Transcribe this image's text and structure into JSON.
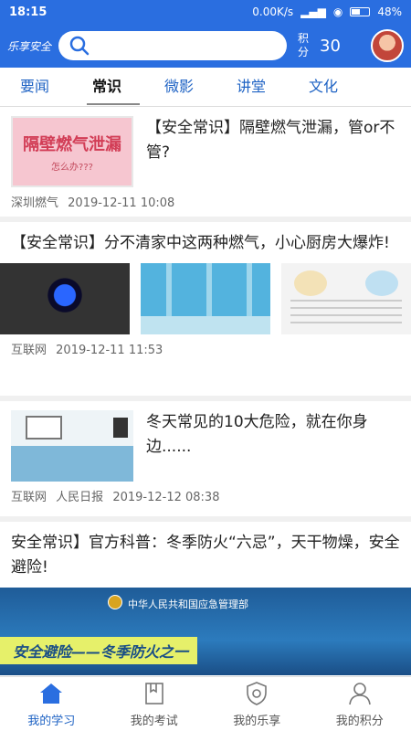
{
  "status_bar": {
    "time": "18:15",
    "network_speed": "0.00K/s",
    "battery": "48%",
    "battery_level": 0.48
  },
  "header": {
    "logo_text": "乐享安全",
    "search_icon": "search-icon",
    "points_label": "积分",
    "points_value": "30"
  },
  "tabs": [
    {
      "label": "要闻",
      "active": false
    },
    {
      "label": "常识",
      "active": true
    },
    {
      "label": "微影",
      "active": false
    },
    {
      "label": "讲堂",
      "active": false
    },
    {
      "label": "文化",
      "active": false
    }
  ],
  "articles": [
    {
      "title": "【安全常识】隔壁燃气泄漏，管or不管?",
      "thumb_big": "隔壁燃气泄漏",
      "thumb_small": "怎么办???",
      "source": "深圳燃气",
      "time": "2019-12-11 10:08"
    },
    {
      "title": "【安全常识】分不清家中这两种燃气，小心厨房大爆炸!",
      "source": "互联网",
      "time": "2019-12-11 11:53"
    },
    {
      "title": "冬天常见的10大危险，就在你身边......",
      "source": "互联网",
      "source2": "人民日报",
      "time": "2019-12-12 08:38"
    },
    {
      "title": "安全常识】官方科普：冬季防火“六忌”，天干物燥，安全避险!",
      "banner_org": "中华人民共和国应急管理部",
      "banner_cta": "安全避险——冬季防火之一"
    }
  ],
  "bottom_nav": [
    {
      "label": "我的学习",
      "icon": "home-icon",
      "active": true
    },
    {
      "label": "我的考试",
      "icon": "book-icon",
      "active": false
    },
    {
      "label": "我的乐享",
      "icon": "shield-icon",
      "active": false
    },
    {
      "label": "我的积分",
      "icon": "user-icon",
      "active": false
    }
  ],
  "colors": {
    "primary": "#2a6ee0",
    "tab_text": "#1f63c4"
  }
}
